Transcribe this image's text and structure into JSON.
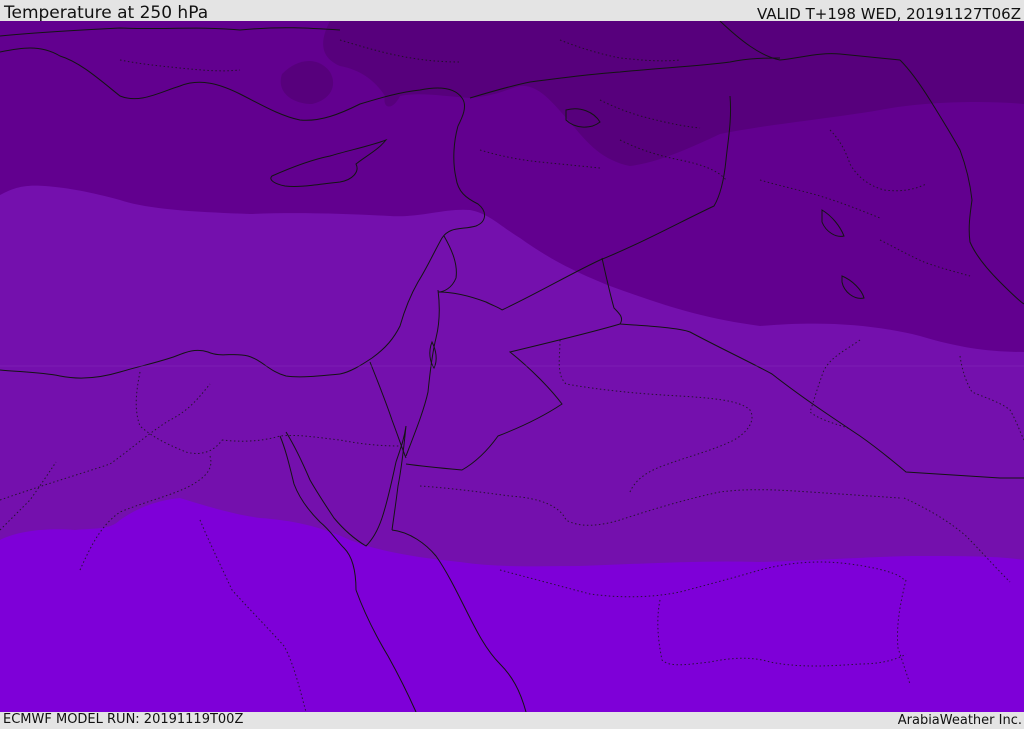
{
  "header": {
    "title": "Temperature at 250 hPa",
    "valid_time": "VALID T+198 WED, 20191127T06Z"
  },
  "footer": {
    "model_run": "ECMWF MODEL RUN: 20191119T00Z",
    "credit": "ArabiaWeather Inc."
  },
  "map": {
    "field": "Temperature at 250 hPa",
    "colors": {
      "band_coldest": "#57007c",
      "band_cold": "#62008f",
      "band_mid": "#7410ad",
      "band_warm": "#7e00d8",
      "coastline": "#141414",
      "border": "#141414"
    }
  }
}
